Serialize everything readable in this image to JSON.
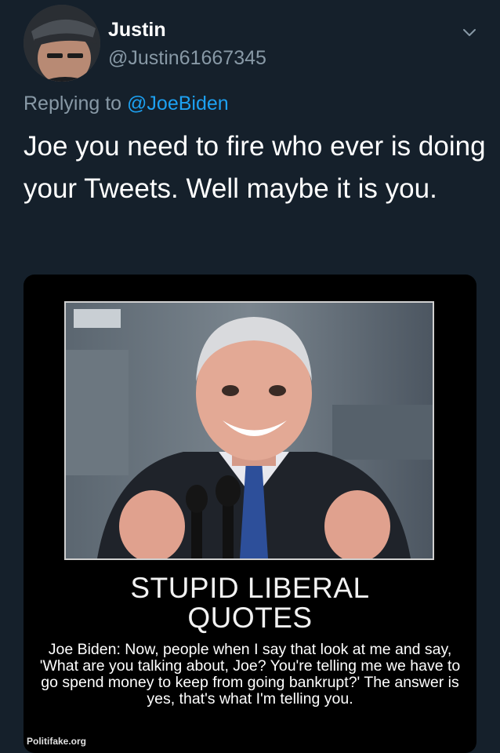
{
  "tweet": {
    "author_name": "Justin",
    "author_handle": "@Justin61667345",
    "reply_prefix": "Replying to",
    "reply_mention": "@JoeBiden",
    "text": "Joe you need to fire who ever is doing your Tweets.  Well maybe it is you."
  },
  "media": {
    "poster_title_line1": "STUPID LIBERAL",
    "poster_title_line2": "QUOTES",
    "poster_quote": "Joe Biden: Now, people when I say that look at me and say, 'What are you talking about, Joe? You're telling me we have to go spend money to keep from going bankrupt?' The answer is yes, that's what I'm telling you.",
    "watermark": "Politifake.org"
  },
  "colors": {
    "background": "#15202b",
    "secondary_text": "#8899a6",
    "link": "#1da1f2"
  },
  "icons": {
    "menu": "chevron-down-icon"
  }
}
